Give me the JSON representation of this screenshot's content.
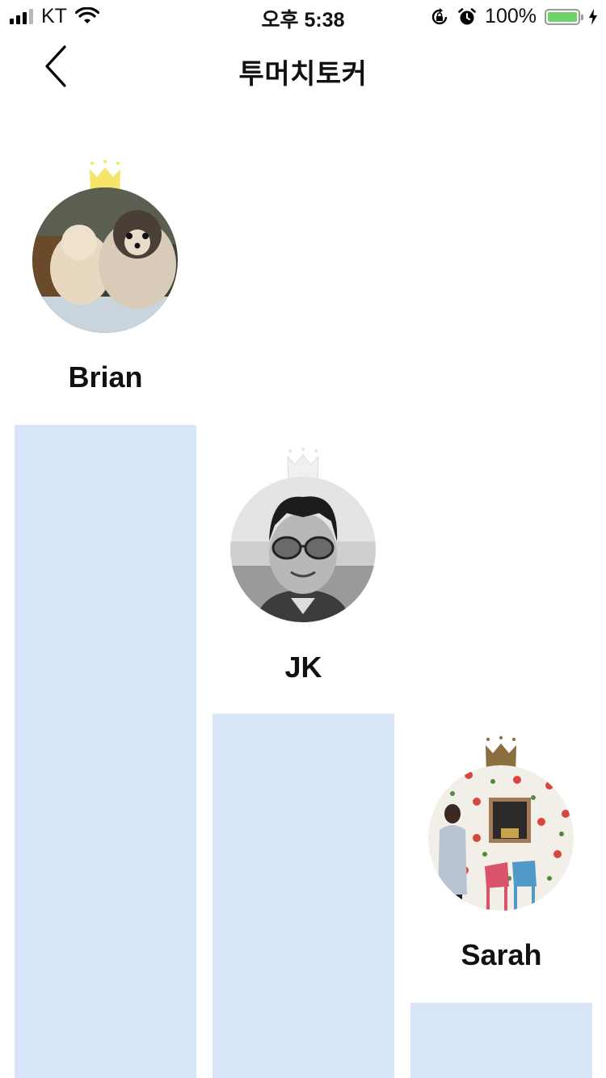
{
  "status_bar": {
    "carrier": "KT",
    "time": "오후 5:38",
    "battery": "100%",
    "battery_level": 1.0
  },
  "nav": {
    "title": "투머치토커",
    "back_icon": "chevron-left-icon"
  },
  "ranking": [
    {
      "rank": 1,
      "name": "Brian",
      "crown_color": "#f5e66a",
      "avatar": "two dogs photo"
    },
    {
      "rank": 2,
      "name": "JK",
      "crown_color": "#f0f0f0",
      "avatar": "memoji with sunglasses"
    },
    {
      "rank": 3,
      "name": "Sarah",
      "crown_color": "#8b6f3e",
      "avatar": "woman by flower wall"
    }
  ],
  "colors": {
    "bar": "#d8e4f7",
    "battery": "#6fd36a"
  }
}
